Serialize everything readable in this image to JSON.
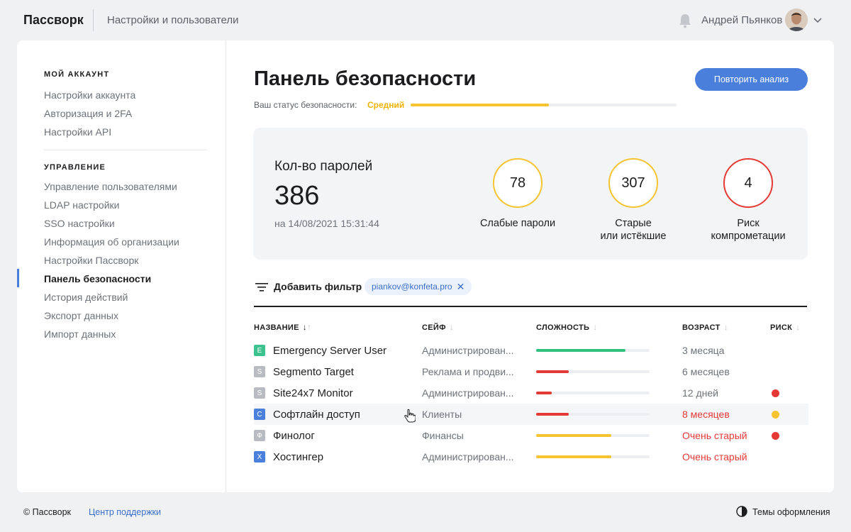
{
  "header": {
    "logo": "Пассворк",
    "section": "Настройки и пользователи",
    "user_name": "Андрей Пьянков"
  },
  "sidebar": {
    "account_heading": "МОЙ АККАУНТ",
    "account_items": [
      "Настройки аккаунта",
      "Авторизация и 2FA",
      "Настройки API"
    ],
    "manage_heading": "УПРАВЛЕНИЕ",
    "manage_items": [
      "Управление пользователями",
      "LDAP настройки",
      "SSO настройки",
      "Информация об организации",
      "Настройки Пассворк",
      "Панель безопасности",
      "История действий",
      "Экспорт данных",
      "Импорт данных"
    ],
    "active_item": "Панель безопасности"
  },
  "main": {
    "title": "Панель безопасности",
    "reanalyze_label": "Повторить анализ",
    "status_label": "Ваш статус безопасности:",
    "status_value": "Средний",
    "status_progress": 0.52,
    "stats": {
      "count_label": "Кол-во паролей",
      "count_value": "386",
      "count_date": "на 14/08/2021 15:31:44",
      "weak": {
        "value": "78",
        "label": "Слабые пароли"
      },
      "old": {
        "value": "307",
        "label_line1": "Старые",
        "label_line2": "или истёкшие"
      },
      "risk": {
        "value": "4",
        "label_line1": "Риск",
        "label_line2": "компрометации"
      }
    },
    "filter": {
      "label": "Добавить фильтр",
      "chip": "piankov@konfeta.pro"
    },
    "table": {
      "columns": [
        "НАЗВАНИЕ",
        "СЕЙФ",
        "СЛОЖНОСТЬ",
        "ВОЗРАСТ",
        "РИСК"
      ],
      "rows": [
        {
          "letter": "E",
          "icon_color": "#3cc28f",
          "name": "Emergency Server User",
          "vault": "Администрирован...",
          "strength": 0.79,
          "strength_color": "#2ec27e",
          "age": "3 месяца",
          "age_bad": false,
          "risk": null
        },
        {
          "letter": "S",
          "icon_color": "#b8bcc2",
          "name": "Segmento Target",
          "vault": "Реклама и продви...",
          "strength": 0.29,
          "strength_color": "#e53935",
          "age": "6 месяцев",
          "age_bad": false,
          "risk": null
        },
        {
          "letter": "S",
          "icon_color": "#b8bcc2",
          "name": "Site24x7 Monitor",
          "vault": "Администрирован...",
          "strength": 0.14,
          "strength_color": "#e53935",
          "age": "12 дней",
          "age_bad": false,
          "risk": "#e53935"
        },
        {
          "letter": "C",
          "icon_color": "#4a7fdc",
          "name": "Софтлайн доступ",
          "vault": "Клиенты",
          "strength": 0.29,
          "strength_color": "#e53935",
          "age": "8 месяцев",
          "age_bad": true,
          "risk": "#f5c430"
        },
        {
          "letter": "Ф",
          "icon_color": "#b8bcc2",
          "name": "Финолог",
          "vault": "Финансы",
          "strength": 0.66,
          "strength_color": "#f5c430",
          "age": "Очень старый",
          "age_bad": true,
          "risk": "#e53935"
        },
        {
          "letter": "X",
          "icon_color": "#4a7fdc",
          "name": "Хостингер",
          "vault": "Администрирован...",
          "strength": 0.66,
          "strength_color": "#f5c430",
          "age": "Очень старый",
          "age_bad": true,
          "risk": null
        }
      ]
    }
  },
  "footer": {
    "copyright": "© Пассворк",
    "support": "Центр поддержки",
    "themes": "Темы оформления"
  },
  "colors": {
    "accent": "#4a7fdc",
    "warning": "#f5c430",
    "danger": "#e53935",
    "success": "#2ec27e"
  }
}
